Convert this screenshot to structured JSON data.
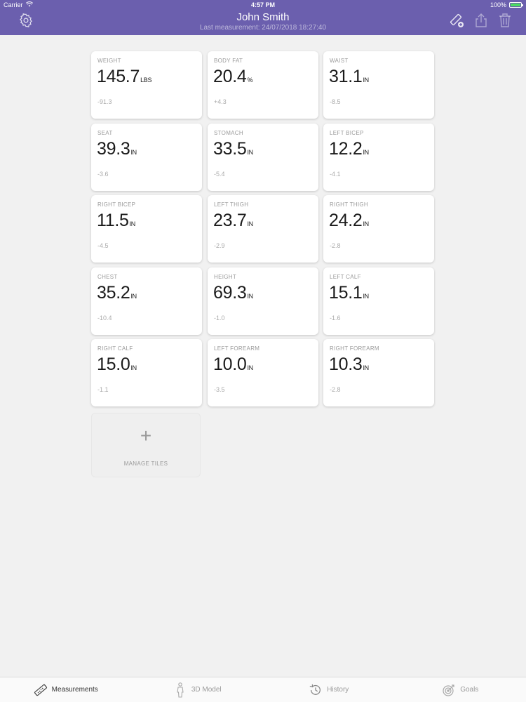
{
  "status_bar": {
    "carrier": "Carrier",
    "time": "4:57 PM",
    "battery": "100%",
    "battery_level": 1.0
  },
  "nav": {
    "title": "John Smith",
    "subtitle": "Last measurement: 24/07/2018 18:27:40",
    "icons": [
      "gear-icon",
      "ruler-add-icon",
      "share-icon",
      "trash-icon"
    ]
  },
  "tiles": [
    {
      "label": "WEIGHT",
      "value": "145.7",
      "unit": "LBS",
      "change": "-91.3"
    },
    {
      "label": "BODY FAT",
      "value": "20.4",
      "unit": "%",
      "change": "+4.3"
    },
    {
      "label": "WAIST",
      "value": "31.1",
      "unit": "IN",
      "change": "-8.5"
    },
    {
      "label": "SEAT",
      "value": "39.3",
      "unit": "IN",
      "change": "-3.6"
    },
    {
      "label": "STOMACH",
      "value": "33.5",
      "unit": "IN",
      "change": "-5.4"
    },
    {
      "label": "LEFT BICEP",
      "value": "12.2",
      "unit": "IN",
      "change": "-4.1"
    },
    {
      "label": "RIGHT BICEP",
      "value": "11.5",
      "unit": "IN",
      "change": "-4.5"
    },
    {
      "label": "LEFT THIGH",
      "value": "23.7",
      "unit": "IN",
      "change": "-2.9"
    },
    {
      "label": "RIGHT THIGH",
      "value": "24.2",
      "unit": "IN",
      "change": "-2.8"
    },
    {
      "label": "CHEST",
      "value": "35.2",
      "unit": "IN",
      "change": "-10.4"
    },
    {
      "label": "HEIGHT",
      "value": "69.3",
      "unit": "IN",
      "change": "-1.0"
    },
    {
      "label": "LEFT CALF",
      "value": "15.1",
      "unit": "IN",
      "change": "-1.6"
    },
    {
      "label": "RIGHT CALF",
      "value": "15.0",
      "unit": "IN",
      "change": "-1.1"
    },
    {
      "label": "LEFT FOREARM",
      "value": "10.0",
      "unit": "IN",
      "change": "-3.5"
    },
    {
      "label": "RIGHT FOREARM",
      "value": "10.3",
      "unit": "IN",
      "change": "-2.8"
    }
  ],
  "manage_tiles": {
    "label": "MANAGE TILES",
    "icon": "plus-icon"
  },
  "tabbar": {
    "active": "Measurements",
    "tabs": [
      {
        "label": "Measurements",
        "icon": "ruler-icon"
      },
      {
        "label": "3D Model",
        "icon": "person-icon"
      },
      {
        "label": "History",
        "icon": "history-icon"
      },
      {
        "label": "Goals",
        "icon": "target-icon"
      }
    ]
  },
  "colors": {
    "accent": "#6b5fae",
    "background": "#f1f1f1",
    "tile": "#ffffff",
    "muted": "#9a9a9a"
  }
}
